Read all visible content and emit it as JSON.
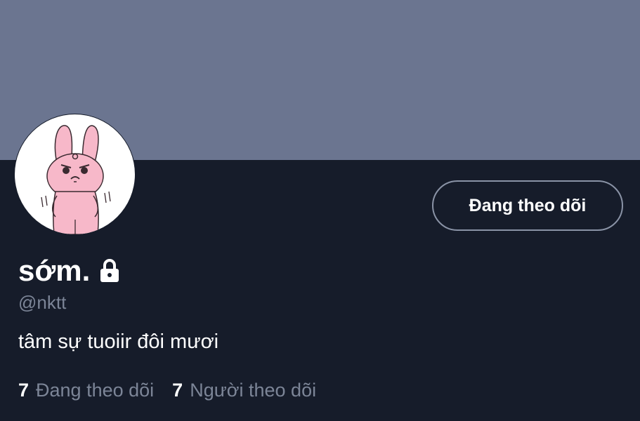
{
  "profile": {
    "display_name": "sớm.",
    "handle": "@nktt",
    "bio": "tâm sự tuoiir đôi mươi",
    "follow_button_label": "Đang theo dõi",
    "locked_icon": "lock-icon",
    "avatar_icon": "pink-bunny-avatar"
  },
  "stats": {
    "following_count": "7",
    "following_label": "Đang theo dõi",
    "followers_count": "7",
    "followers_label": "Người theo dõi"
  },
  "colors": {
    "banner": "#6b7590",
    "background": "#161c2a",
    "primary_text": "#ffffff",
    "secondary_text": "#7c8597",
    "button_border": "#8a93a6"
  }
}
